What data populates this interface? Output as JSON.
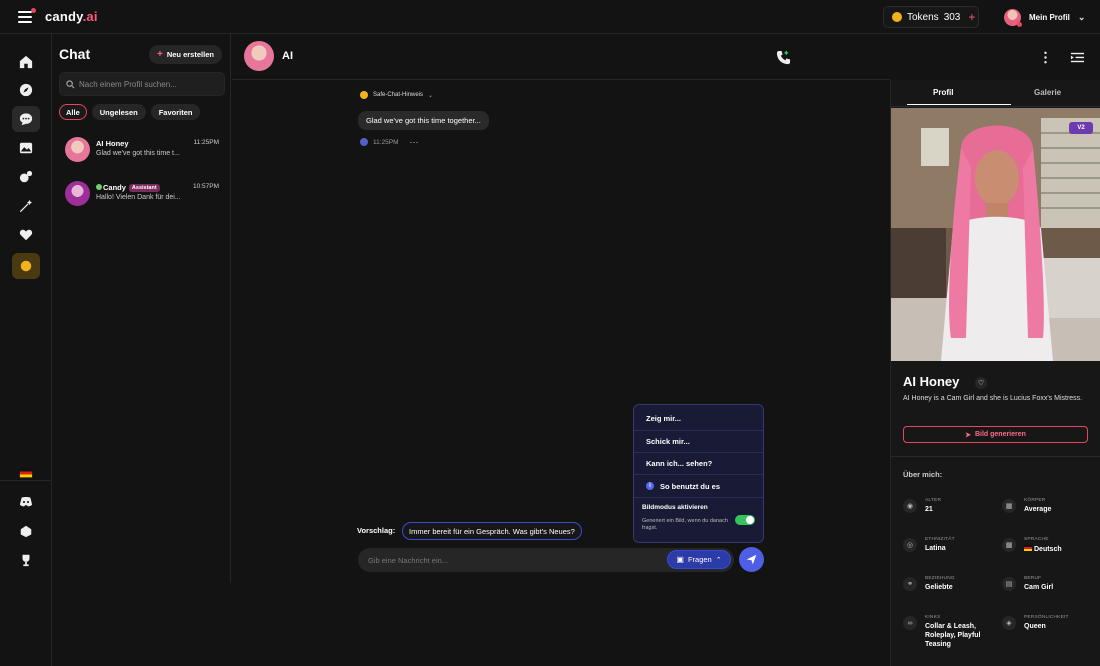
{
  "topbar": {
    "logo_main": "candy",
    "logo_accent": ".ai",
    "tokens_label": "Tokens",
    "tokens_count": "303",
    "tokens_plus": "+",
    "profile_label": "Mein Profil"
  },
  "nav": {
    "icons": [
      "home-icon",
      "compass-icon",
      "chat-icon",
      "gallery-icon",
      "generate-icon",
      "magic-wand-icon",
      "heart-icon",
      "coin-icon",
      "german-flag-icon",
      "discord-icon",
      "affiliate-icon",
      "trophy-icon"
    ]
  },
  "chatlist": {
    "title": "Chat",
    "new_button": "Neu erstellen",
    "search_placeholder": "Nach einem Profil suchen...",
    "filters": [
      "Alle",
      "Ungelesen",
      "Favoriten"
    ],
    "items": [
      {
        "name": "AI Honey",
        "time": "11:25PM",
        "message": "Glad we've got this time t..."
      },
      {
        "name": "Candy",
        "badge": "Assistant",
        "time": "10:57PM",
        "message": "Hallo! Vielen Dank für dei..."
      }
    ]
  },
  "chat": {
    "header_name": "AI",
    "safe_label": "Safe-Chat-Hinweis",
    "bubble_text": "Glad we've got this time together...",
    "message_time": "11:25PM",
    "more_dots": "···",
    "popup": {
      "items": [
        "Zeig mir...",
        "Schick mir...",
        "Kann ich... sehen?"
      ],
      "help_label": "So benutzt du es",
      "mode_title": "Bildmodus aktivieren",
      "mode_desc": "Generiert ein Bild, wenn du danach fragst."
    },
    "suggestion_label": "Vorschlag:",
    "suggestion_text": "Immer bereit für ein Gespräch. Was gibt's Neues?",
    "input_placeholder": "Gib eine Nachricht ein...",
    "fragen_label": "Fragen"
  },
  "profile": {
    "tabs": [
      "Profil",
      "Galerie"
    ],
    "version_badge": "V2",
    "name": "AI Honey",
    "description": "AI Honey is a Cam Girl and she is Lucius Foxx's Mistress.",
    "generate_button": "Bild generieren",
    "about_title": "Über mich:",
    "attributes": [
      {
        "key": "ALTER",
        "value": "21"
      },
      {
        "key": "KÖRPER",
        "value": "Average"
      },
      {
        "key": "ETHNIZITÄT",
        "value": "Latina"
      },
      {
        "key": "SPRACHE",
        "value": "Deutsch"
      },
      {
        "key": "BEZIEHUNG",
        "value": "Geliebte"
      },
      {
        "key": "BERUF",
        "value": "Cam Girl"
      },
      {
        "key": "KINKS",
        "value": "Collar & Leash, Roleplay, Playful Teasing"
      },
      {
        "key": "PERSÖNLICHKEIT",
        "value": "Queen"
      }
    ]
  },
  "colors": {
    "accent_pink": "#ff5b7f",
    "accent_blue": "#4e5fe6",
    "toggle_green": "#34c45a",
    "coin_gold": "#f2b21c"
  }
}
